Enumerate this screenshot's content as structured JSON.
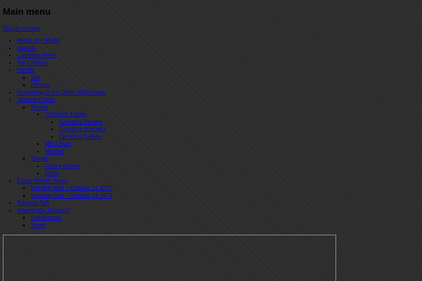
{
  "header": {
    "menu_title": "Main menu",
    "skip_link": "Skip to content"
  },
  "menu": {
    "about": "About Jim Wright",
    "awards": "Awards",
    "cosmetic_relief": "Cosmetic Relief",
    "for_children": "For Children",
    "novels": "Novels",
    "novels_sub": {
      "item1": "Sixt",
      "item2": "Hitches"
    },
    "pioneering": "Pioneering in the Urban Wilderness",
    "science_fiction": "Science Fiction",
    "sf_sub": {
      "novels": "Novels",
      "novels_sub": {
        "corridors_trilogy": "Corridors Trilogy",
        "corridors_sub": {
          "parallel": "Corridors Parallel",
          "intersect": "Corridors Intersect",
          "collide": "Corridors Collide"
        },
        "mind_hunt": "Mind Hunt",
        "montral": "Montral"
      },
      "stories": "Stories",
      "stories_sub": {
        "future_history": "Future History",
        "other": "Other"
      }
    },
    "exotic_weekly": "Exotic Weekly News",
    "exotic_sub": {
      "item1": "Keeping Aloft – October 11 1975",
      "item2": "Keeping Aloft – October 18 1975"
    },
    "tobacco_talk": "Tobacco Talk",
    "walking": "Walking the Dungeon",
    "walking_sub": {
      "item1": "Ferndromes",
      "item2": "Verse"
    }
  }
}
